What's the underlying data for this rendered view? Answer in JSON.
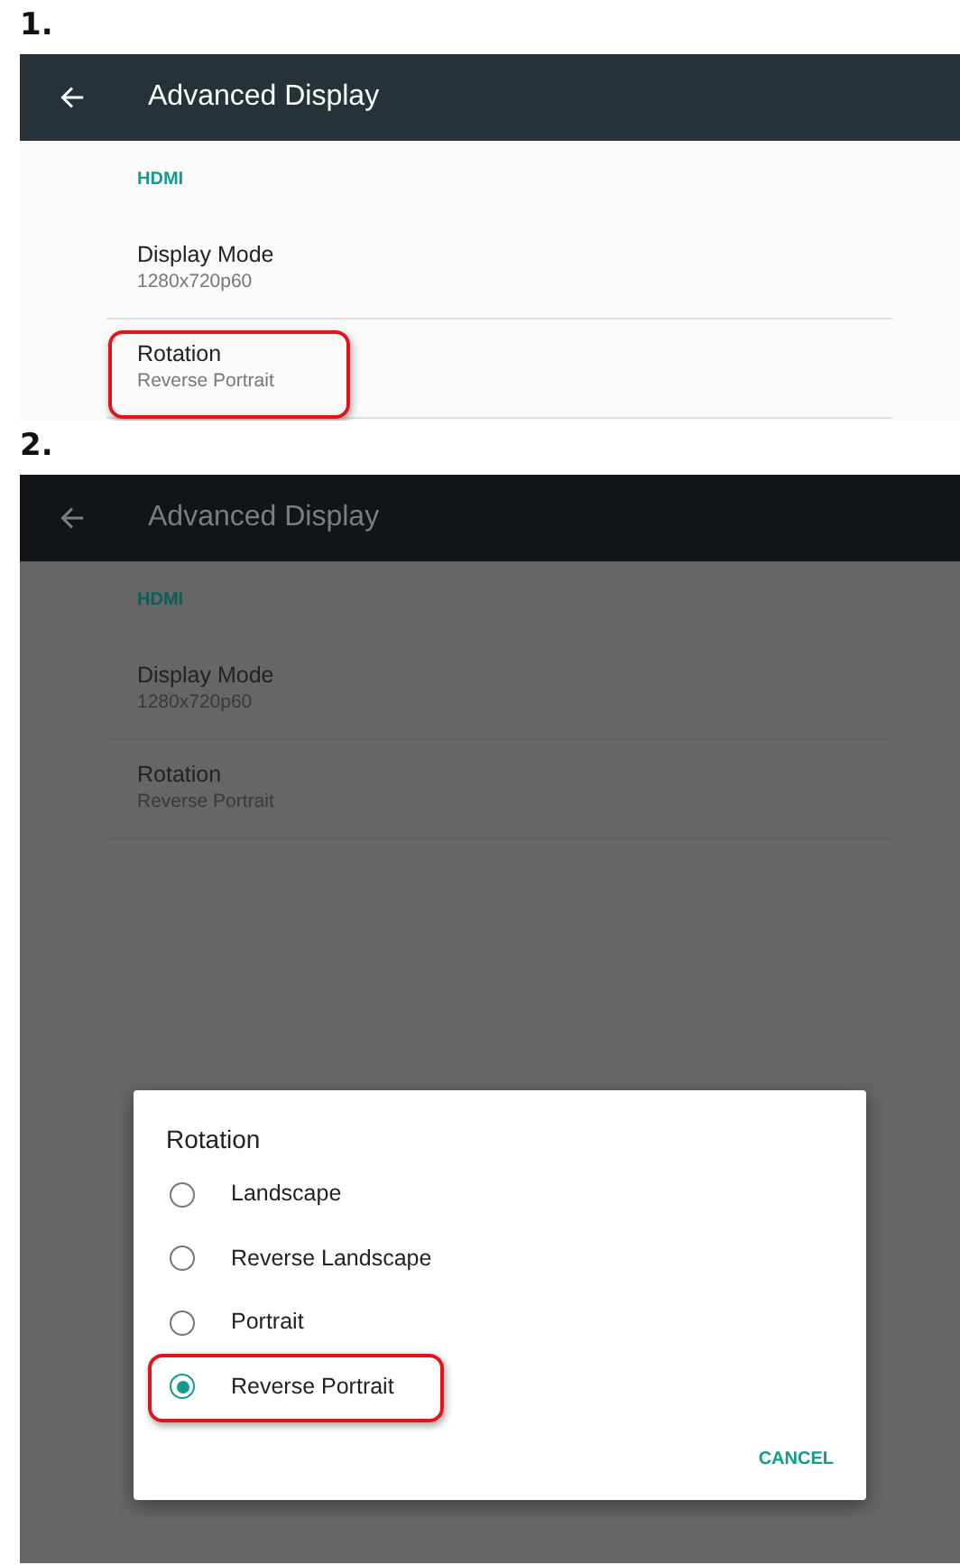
{
  "steps": [
    {
      "label": "1.",
      "screen": {
        "dimmed": false,
        "toolbar": {
          "title": "Advanced Display"
        },
        "category": "HDMI",
        "preferences": [
          {
            "title": "Display Mode",
            "summary": "1280x720p60",
            "highlighted": false
          },
          {
            "title": "Rotation",
            "summary": "Reverse Portrait",
            "highlighted": true
          }
        ]
      }
    },
    {
      "label": "2.",
      "screen": {
        "dimmed": true,
        "toolbar": {
          "title": "Advanced Display"
        },
        "category": "HDMI",
        "preferences": [
          {
            "title": "Display Mode",
            "summary": "1280x720p60",
            "highlighted": false
          },
          {
            "title": "Rotation",
            "summary": "Reverse Portrait",
            "highlighted": false
          }
        ]
      },
      "dialog": {
        "title": "Rotation",
        "options": [
          {
            "label": "Landscape",
            "selected": false,
            "highlighted": false
          },
          {
            "label": "Reverse Landscape",
            "selected": false,
            "highlighted": false
          },
          {
            "label": "Portrait",
            "selected": false,
            "highlighted": false
          },
          {
            "label": "Reverse Portrait",
            "selected": true,
            "highlighted": true
          }
        ],
        "buttons": [
          "CANCEL"
        ]
      }
    }
  ]
}
